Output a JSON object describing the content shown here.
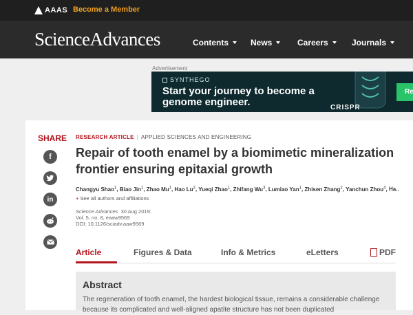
{
  "topbar": {
    "aaas": "AAAS",
    "become_member": "Become a Member"
  },
  "header": {
    "brand": "ScienceAdvances",
    "nav": [
      "Contents",
      "News",
      "Careers",
      "Journals"
    ]
  },
  "ad": {
    "label": "Advertisement",
    "brand": "SYNTHEGO",
    "headline": "Start your journey to become a genome engineer.",
    "crispr": "CRISPR",
    "button": "Re"
  },
  "share": {
    "label": "SHARE",
    "icons": [
      "facebook-icon",
      "twitter-icon",
      "linkedin-icon",
      "reddit-icon",
      "email-icon"
    ]
  },
  "article": {
    "type": "RESEARCH ARTICLE",
    "category": "APPLIED SCIENCES AND ENGINEERING",
    "title": "Repair of tooth enamel by a biomimetic mineralization frontier ensuring epitaxial growth",
    "authors": [
      {
        "name": "Changyu Shao",
        "aff": "1"
      },
      {
        "name": "Biao Jin",
        "aff": "1"
      },
      {
        "name": "Zhao Mu",
        "aff": "1"
      },
      {
        "name": "Hao Lu",
        "aff": "2"
      },
      {
        "name": "Yueqi Zhao",
        "aff": "1"
      },
      {
        "name": "Zhifang Wu",
        "aff": "3"
      },
      {
        "name": "Lumiao Yan",
        "aff": "1"
      },
      {
        "name": "Zhisen Zhang",
        "aff": "2"
      },
      {
        "name": "Yanchun Zhou",
        "aff": "4"
      },
      {
        "name": "Ha...",
        "aff": ""
      }
    ],
    "see_all": "See all authors and affiliations",
    "journal": "Science Advances",
    "date": "30 Aug 2019:",
    "volume": "Vol. 5, no. 8, eaaw9569",
    "doi": "DOI: 10.1126/sciadv.aaw9569"
  },
  "tabs": [
    "Article",
    "Figures & Data",
    "Info & Metrics",
    "eLetters",
    "PDF"
  ],
  "abstract": {
    "heading": "Abstract",
    "text": "The regeneration of tooth enamel, the hardest biological tissue, remains a considerable challenge because its complicated and well-aligned apatite structure has not been duplicated"
  }
}
